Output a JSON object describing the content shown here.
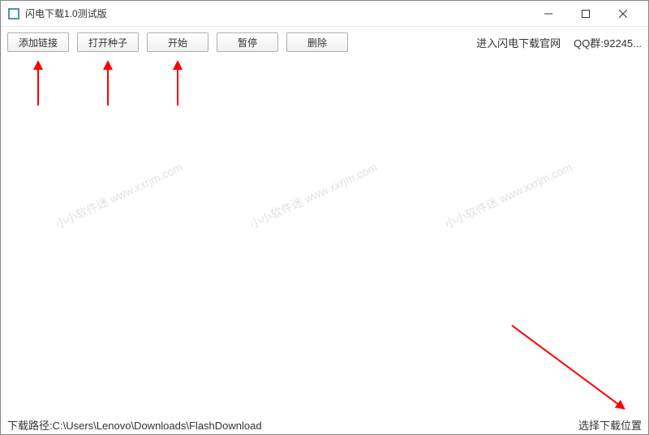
{
  "window": {
    "title": "闪电下载1.0测试版"
  },
  "toolbar": {
    "add_link": "添加链接",
    "open_seed": "打开种子",
    "start": "开始",
    "pause": "暂停",
    "delete": "删除",
    "official_site": "进入闪电下载官网",
    "qq_group": "QQ群:92245..."
  },
  "watermark": {
    "text": "小小软件迷 www.xxrjm.com"
  },
  "statusbar": {
    "path_label": "下载路径:",
    "path_value": "C:\\Users\\Lenovo\\Downloads\\FlashDownload",
    "choose_location": "选择下载位置"
  }
}
